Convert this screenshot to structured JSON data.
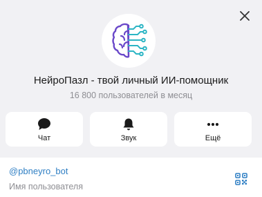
{
  "profile": {
    "title": "НейроПазл - твой личный ИИ-помощник",
    "subtitle": "16 800 пользователей в месяц",
    "avatar_icon": "brain-circuit-icon"
  },
  "actions": [
    {
      "label": "Чат",
      "icon": "chat-bubble-icon"
    },
    {
      "label": "Звук",
      "icon": "bell-icon"
    },
    {
      "label": "Ещё",
      "icon": "more-dots-icon"
    }
  ],
  "info": {
    "username": "@pbneyro_bot",
    "username_caption": "Имя пользователя",
    "qr_icon": "qr-code-icon"
  },
  "colors": {
    "background": "#f1f1f4",
    "card": "#ffffff",
    "link": "#2f7fc4",
    "secondary_text": "#8e8e93",
    "brand_purple": "#6a48c9",
    "brand_teal": "#2bb5c4"
  }
}
